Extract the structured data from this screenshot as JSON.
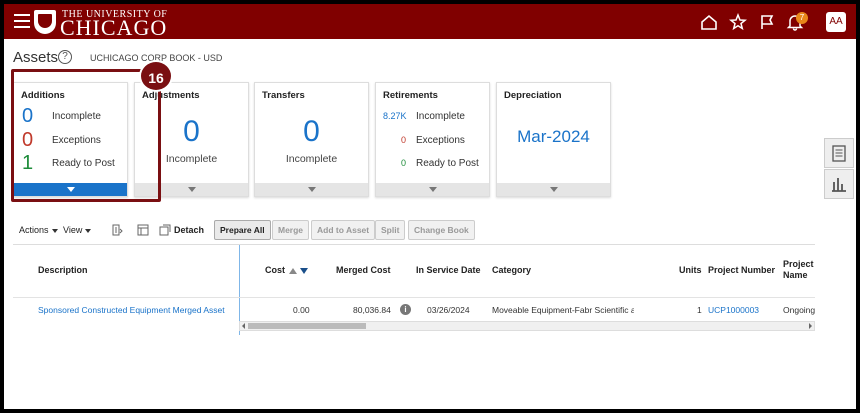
{
  "header": {
    "logo_small": "THE UNIVERSITY OF",
    "logo_big": "CHICAGO",
    "notification_count": "7",
    "avatar_initials": "AA",
    "brand_color": "#800000"
  },
  "page": {
    "title": "Assets",
    "book": "UCHICAGO CORP BOOK - USD"
  },
  "annotation": {
    "step": "16",
    "highlight_color": "#7a0f12"
  },
  "cards": {
    "additions": {
      "title": "Additions",
      "rows": [
        {
          "value": "0",
          "label": "Incomplete"
        },
        {
          "value": "0",
          "label": "Exceptions"
        },
        {
          "value": "1",
          "label": "Ready to Post"
        }
      ]
    },
    "adjustments": {
      "title": "Adjustments",
      "value": "0",
      "label": "Incomplete"
    },
    "transfers": {
      "title": "Transfers",
      "value": "0",
      "label": "Incomplete"
    },
    "retirements": {
      "title": "Retirements",
      "rows": [
        {
          "value": "8.27K",
          "label": "Incomplete"
        },
        {
          "value": "0",
          "label": "Exceptions"
        },
        {
          "value": "0",
          "label": "Ready to Post"
        }
      ]
    },
    "depreciation": {
      "title": "Depreciation",
      "value": "Mar-2024"
    }
  },
  "toolbar": {
    "actions": "Actions",
    "view": "View",
    "detach": "Detach",
    "prepare_all": "Prepare All",
    "merge": "Merge",
    "add_to_asset": "Add to Asset",
    "split": "Split",
    "change_book": "Change Book"
  },
  "table": {
    "columns": [
      "Description",
      "Cost",
      "Merged Cost",
      "In Service Date",
      "Category",
      "Units",
      "Project Number",
      "Project Name"
    ],
    "project_name_line2": "Name",
    "rows": [
      {
        "description": "Sponsored Constructed Equipment Merged Asset",
        "cost": "0.00",
        "merged_cost": "80,036.84",
        "in_service_date": "03/26/2024",
        "category": "Moveable Equipment-Fabr Scientific ar",
        "units": "1",
        "project_number": "UCP1000003",
        "project_name": "Ongoing"
      }
    ]
  }
}
